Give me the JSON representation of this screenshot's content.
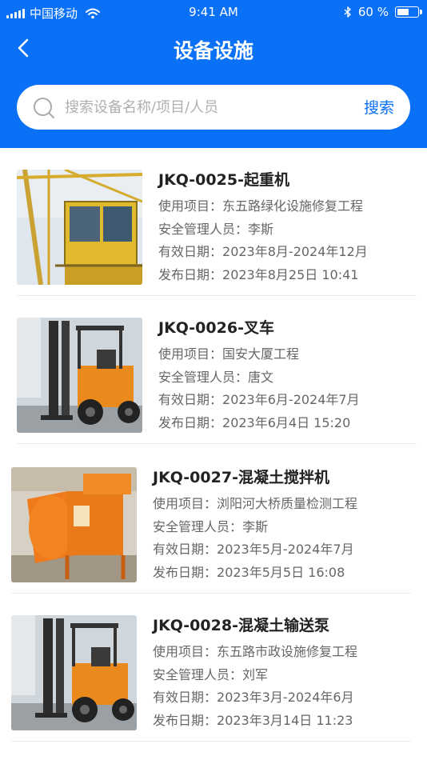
{
  "status_bar": {
    "carrier": "中国移动",
    "time": "9:41 AM",
    "battery": "60 %",
    "battery_level": 0.6
  },
  "nav": {
    "title": "设备设施",
    "back_icon": "chevron-left-icon"
  },
  "search": {
    "placeholder": "搜索设备名称/项目/人员",
    "value": "",
    "button_label": "搜索",
    "icon": "search-icon"
  },
  "labels": {
    "project": "使用项目：",
    "manager": "安全管理人员：",
    "valid": "有效日期：",
    "published": "发布日期："
  },
  "items": [
    {
      "title": "JKQ-0025-起重机",
      "project": "东五路绿化设施修复工程",
      "manager": "李斯",
      "valid": "2023年8月-2024年12月",
      "published": "2023年8月25日  10:41",
      "image": "tower-crane-cab"
    },
    {
      "title": "JKQ-0026-叉车",
      "project": "国安大厦工程",
      "manager": "唐文",
      "valid": "2023年6月-2024年7月",
      "published": "2023年6月4日   15:20",
      "image": "forklift"
    },
    {
      "title": "JKQ-0027-混凝土搅拌机",
      "project": "浏阳河大桥质量检测工程",
      "manager": "李斯",
      "valid": "2023年5月-2024年7月",
      "published": "2023年5月5日   16:08",
      "image": "concrete-mixer"
    },
    {
      "title": "JKQ-0028-混凝土输送泵",
      "project": "东五路市政设施修复工程",
      "manager": "刘军",
      "valid": "2023年3月-2024年6月",
      "published": "2023年3月14日   11:23",
      "image": "forklift"
    }
  ],
  "colors": {
    "primary": "#0a70f5",
    "background": "#ffffff",
    "title_text": "#222222",
    "body_text": "#666666",
    "divider": "#ececec"
  }
}
